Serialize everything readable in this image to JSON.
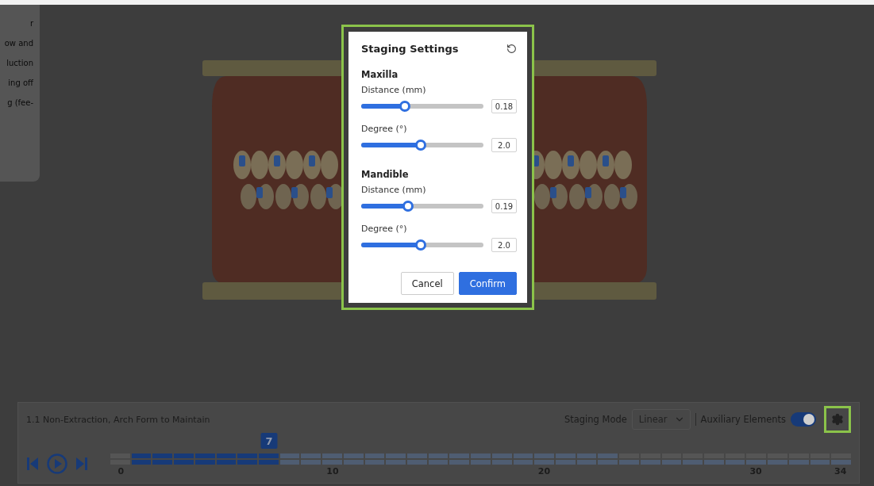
{
  "side_panel": {
    "items": [
      "r",
      "ow and",
      "luction",
      "ing off",
      "g (fee-"
    ]
  },
  "dialog": {
    "title": "Staging Settings",
    "groups": [
      {
        "title": "Maxilla",
        "sliders": [
          {
            "label": "Distance (mm)",
            "level": 0.36,
            "value": "0.18"
          },
          {
            "label": "Degree (°)",
            "level": 0.49,
            "value": "2.0"
          }
        ]
      },
      {
        "title": "Mandible",
        "sliders": [
          {
            "label": "Distance (mm)",
            "level": 0.38,
            "value": "0.19"
          },
          {
            "label": "Degree (°)",
            "level": 0.49,
            "value": "2.0"
          }
        ]
      }
    ],
    "buttons": [
      {
        "label": "Cancel",
        "kind": "secondary"
      },
      {
        "label": "Confirm",
        "kind": "primary"
      }
    ]
  },
  "timeline_panel": {
    "plan": "1.1 Non-Extraction, Arch Form to Maintain",
    "staging_mode": {
      "label": "Staging Mode",
      "value": "Linear"
    },
    "auxiliary": {
      "label": "Auxiliary Elements",
      "on": true
    },
    "current_stage": "7",
    "rows": [
      [
        {
          "kind": "none"
        },
        {
          "kind": "done"
        },
        {
          "kind": "done"
        },
        {
          "kind": "done"
        },
        {
          "kind": "done"
        },
        {
          "kind": "done"
        },
        {
          "kind": "done"
        },
        {
          "kind": "done"
        },
        {
          "kind": "planned"
        },
        {
          "kind": "planned"
        },
        {
          "kind": "planned"
        },
        {
          "kind": "planned"
        },
        {
          "kind": "planned"
        },
        {
          "kind": "planned"
        },
        {
          "kind": "planned"
        },
        {
          "kind": "planned"
        },
        {
          "kind": "planned"
        },
        {
          "kind": "planned"
        },
        {
          "kind": "planned"
        },
        {
          "kind": "planned"
        },
        {
          "kind": "planned"
        },
        {
          "kind": "planned"
        },
        {
          "kind": "planned"
        },
        {
          "kind": "planned"
        },
        {
          "kind": "none"
        },
        {
          "kind": "none"
        },
        {
          "kind": "none"
        },
        {
          "kind": "none"
        },
        {
          "kind": "none"
        },
        {
          "kind": "none"
        },
        {
          "kind": "none"
        },
        {
          "kind": "none"
        },
        {
          "kind": "none"
        },
        {
          "kind": "none"
        },
        {
          "kind": "none"
        }
      ],
      [
        {
          "kind": "none"
        },
        {
          "kind": "done"
        },
        {
          "kind": "done"
        },
        {
          "kind": "done"
        },
        {
          "kind": "done"
        },
        {
          "kind": "done"
        },
        {
          "kind": "done"
        },
        {
          "kind": "done"
        },
        {
          "kind": "planned"
        },
        {
          "kind": "planned"
        },
        {
          "kind": "planned"
        },
        {
          "kind": "planned"
        },
        {
          "kind": "planned"
        },
        {
          "kind": "planned"
        },
        {
          "kind": "planned"
        },
        {
          "kind": "planned"
        },
        {
          "kind": "planned"
        },
        {
          "kind": "planned"
        },
        {
          "kind": "planned"
        },
        {
          "kind": "planned"
        },
        {
          "kind": "planned"
        },
        {
          "kind": "planned"
        },
        {
          "kind": "planned"
        },
        {
          "kind": "planned"
        },
        {
          "kind": "planned"
        },
        {
          "kind": "planned"
        },
        {
          "kind": "planned"
        },
        {
          "kind": "planned"
        },
        {
          "kind": "planned"
        },
        {
          "kind": "planned"
        },
        {
          "kind": "planned"
        },
        {
          "kind": "planned"
        },
        {
          "kind": "planned"
        },
        {
          "kind": "planned"
        },
        {
          "kind": "planned"
        }
      ]
    ],
    "ticks": [
      "0",
      "10",
      "20",
      "30",
      "34"
    ]
  }
}
